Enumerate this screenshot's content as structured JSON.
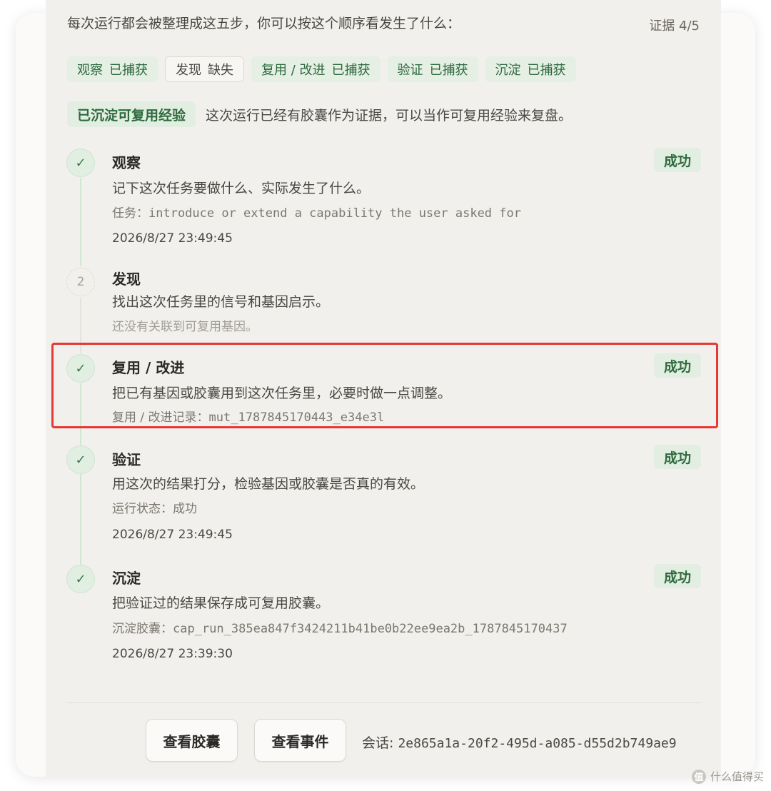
{
  "header": {
    "intro": "每次运行都会被整理成这五步，你可以按这个顺序看发生了什么：",
    "evidence": "证据 4/5"
  },
  "chips": [
    {
      "name": "观察",
      "status": "已捕获"
    },
    {
      "name": "发现",
      "status": "缺失"
    },
    {
      "name": "复用 / 改进",
      "status": "已捕获"
    },
    {
      "name": "验证",
      "status": "已捕获"
    },
    {
      "name": "沉淀",
      "status": "已捕获"
    }
  ],
  "summary": {
    "badge": "已沉淀可复用经验",
    "text": "这次运行已经有胶囊作为证据，可以当作可复用经验来复盘。"
  },
  "steps": [
    {
      "marker": "✓",
      "title": "观察",
      "status": "成功",
      "desc": "记下这次任务要做什么、实际发生了什么。",
      "detail_label": "任务：",
      "detail_value": "introduce or extend a capability the user asked for",
      "time": "2026/8/27 23:49:45"
    },
    {
      "marker": "2",
      "title": "发现",
      "desc": "找出这次任务里的信号和基因启示。",
      "detail": "还没有关联到可复用基因。"
    },
    {
      "marker": "✓",
      "title": "复用 / 改进",
      "status": "成功",
      "desc": "把已有基因或胶囊用到这次任务里，必要时做一点调整。",
      "detail_label": "复用 / 改进记录：",
      "detail_value": "mut_1787845170443_e34e3l"
    },
    {
      "marker": "✓",
      "title": "验证",
      "status": "成功",
      "desc": "用这次的结果打分，检验基因或胶囊是否真的有效。",
      "detail": "运行状态：成功",
      "time": "2026/8/27 23:49:45"
    },
    {
      "marker": "✓",
      "title": "沉淀",
      "status": "成功",
      "desc": "把验证过的结果保存成可复用胶囊。",
      "detail_label": "沉淀胶囊：",
      "detail_value": "cap_run_385ea847f3424211b41be0b22ee9ea2b_1787845170437",
      "time": "2026/8/27 23:39:30"
    }
  ],
  "actions": {
    "view_capsule": "查看胶囊",
    "view_events": "查看事件",
    "session_label": "会话: ",
    "session_id": "2e865a1a-20f2-495d-a085-d55d2b749ae9"
  },
  "watermark": {
    "logo": "值",
    "text": "什么值得买"
  },
  "colors": {
    "success_bg": "#e2eee1",
    "success_text": "#2e6a3e",
    "highlight": "#e53935",
    "timeline": "#cfe6d1"
  }
}
